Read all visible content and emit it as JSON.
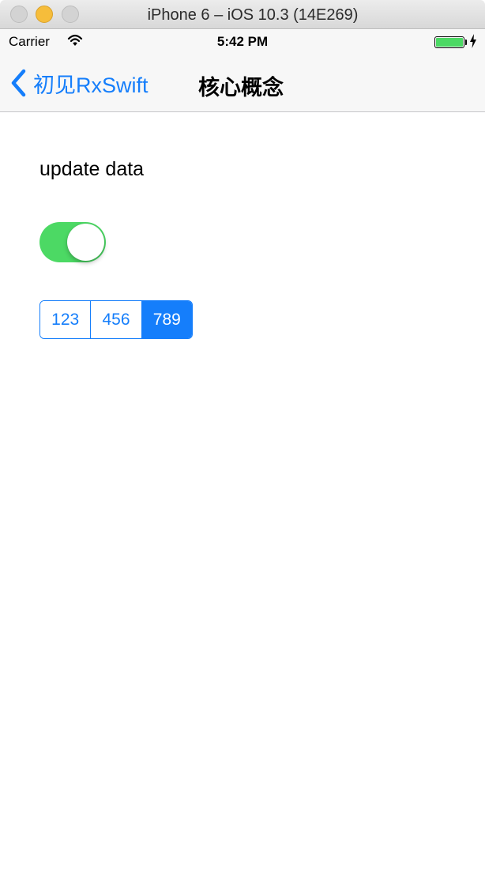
{
  "window": {
    "title": "iPhone 6 – iOS 10.3 (14E269)"
  },
  "status_bar": {
    "carrier": "Carrier",
    "time": "5:42 PM",
    "battery_level": 1.0
  },
  "nav_bar": {
    "back_label": "初见RxSwift",
    "title": "核心概念"
  },
  "content": {
    "update_label": "update data",
    "switch_on": true,
    "segments": [
      {
        "label": "123",
        "selected": false
      },
      {
        "label": "456",
        "selected": false
      },
      {
        "label": "789",
        "selected": true
      }
    ]
  },
  "colors": {
    "ios_blue": "#157efb",
    "switch_green": "#4cd964",
    "minimize_yellow": "#f6bd3b"
  }
}
